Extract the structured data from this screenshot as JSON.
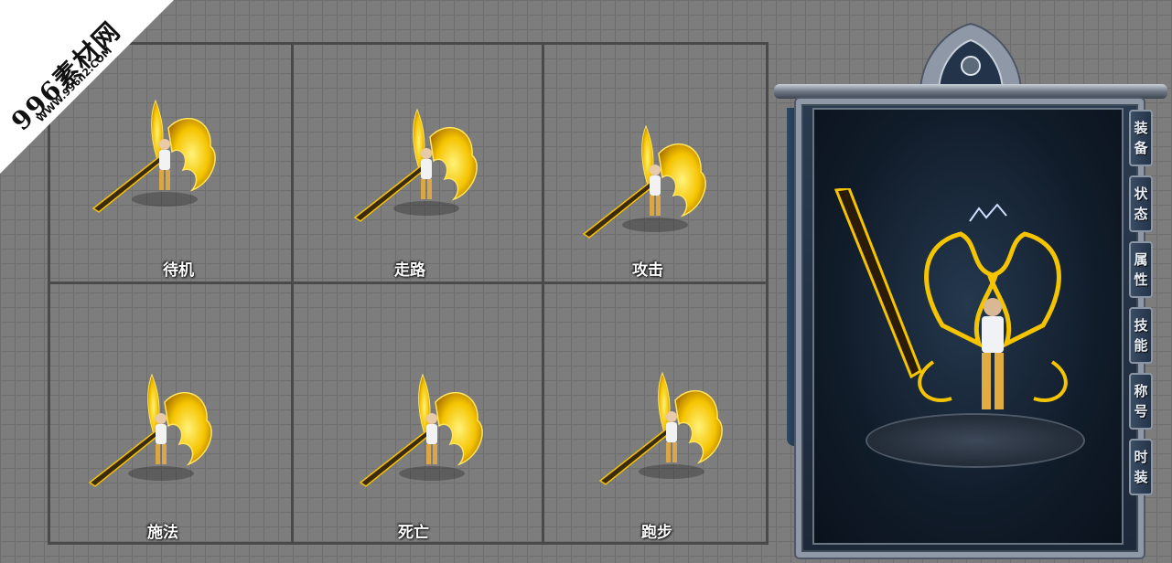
{
  "watermark": {
    "brand": "996素材网",
    "url": "WWW.996n2.COM"
  },
  "animations": [
    {
      "label": "待机"
    },
    {
      "label": "走路"
    },
    {
      "label": "攻击"
    },
    {
      "label": "施法"
    },
    {
      "label": "死亡"
    },
    {
      "label": "跑步"
    }
  ],
  "character_panel": {
    "tabs": [
      {
        "chars": [
          "装",
          "备"
        ]
      },
      {
        "chars": [
          "状",
          "态"
        ]
      },
      {
        "chars": [
          "属",
          "性"
        ]
      },
      {
        "chars": [
          "技",
          "能"
        ]
      },
      {
        "chars": [
          "称",
          "号"
        ]
      },
      {
        "chars": [
          "时",
          "装"
        ]
      }
    ]
  },
  "colors": {
    "gold": "#f5c400",
    "gold_dark": "#a86f00",
    "frame_steel": "#8e98a6",
    "panel_bg": "#1d2838"
  }
}
